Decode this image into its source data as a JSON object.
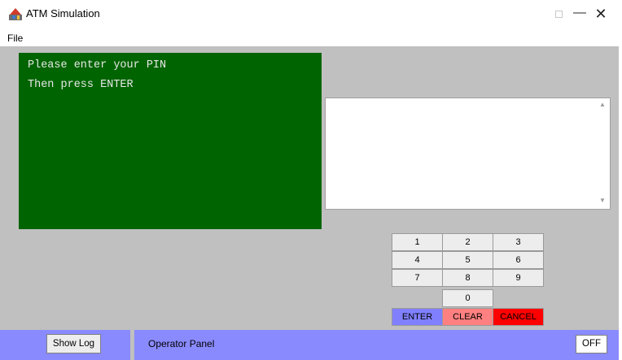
{
  "window": {
    "title": "ATM Simulation",
    "icon": "atm-app-icon",
    "controls": {
      "minimize": "—",
      "maximize": "maximize-icon",
      "close": "✕"
    }
  },
  "menu": {
    "file": "File"
  },
  "display": {
    "lines": [
      "Please enter your PIN",
      "Then press ENTER"
    ],
    "background": "#006400"
  },
  "log": {
    "content": ""
  },
  "keypad": {
    "keys": [
      "1",
      "2",
      "3",
      "4",
      "5",
      "6",
      "7",
      "8",
      "9",
      "0"
    ],
    "enter": "ENTER",
    "clear": "CLEAR",
    "cancel": "CANCEL"
  },
  "operator_panel": {
    "show_log": "Show Log",
    "label": "Operator Panel",
    "power": "OFF",
    "background": "#8a8aff"
  }
}
